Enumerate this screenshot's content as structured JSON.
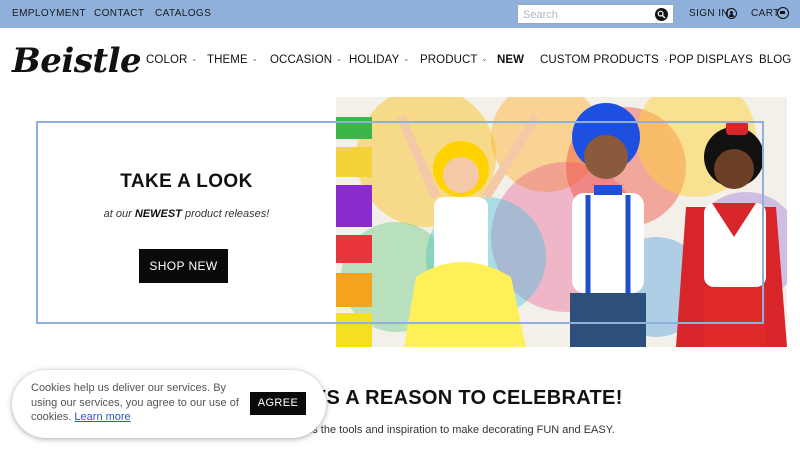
{
  "topbar": {
    "links": [
      "EMPLOYMENT",
      "CONTACT",
      "CATALOGS"
    ],
    "search_placeholder": "Search",
    "signin_label": "SIGN IN",
    "cart_label": "CART",
    "background": "#8fb0db"
  },
  "brand": {
    "logo_text": "Beistle"
  },
  "nav": {
    "items": [
      {
        "label": "COLOR"
      },
      {
        "label": "THEME"
      },
      {
        "label": "OCCASION"
      },
      {
        "label": "HOLIDAY"
      },
      {
        "label": "PRODUCT"
      },
      {
        "label": "NEW"
      },
      {
        "label": "CUSTOM PRODUCTS"
      },
      {
        "label": "POP DISPLAYS"
      },
      {
        "label": "BLOG"
      }
    ]
  },
  "hero": {
    "title": "TAKE A LOOK",
    "subtitle_pre": "at our ",
    "subtitle_emphasis": "NEWEST",
    "subtitle_post": " product releases!",
    "button_label": "SHOP NEW",
    "frame_color": "#8fb0db"
  },
  "section": {
    "title": "AYS A REASON TO CELEBRATE!",
    "text": "des the tools and inspiration to make decorating FUN and EASY."
  },
  "cookie": {
    "text": "Cookies help us deliver our services. By using our services, you agree to our use of cookies.",
    "learn_more": "Learn more",
    "agree_label": "AGREE"
  }
}
